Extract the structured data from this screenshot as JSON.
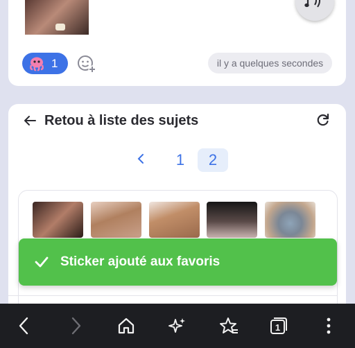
{
  "previous_post": {
    "reaction_count": "1",
    "timestamp": "il y a quelques secondes"
  },
  "topic_card": {
    "back_title": "Retou à liste des sujets",
    "pagination": {
      "pages": [
        "1",
        "2"
      ],
      "current": "2"
    }
  },
  "toast": {
    "message": "Sticker ajouté aux favoris"
  },
  "nav": {
    "tab_count": "1",
    "items": [
      "back-icon",
      "forward-icon",
      "home-icon",
      "sparkle-icon",
      "favorites-star-icon",
      "tabs-icon",
      "menu-icon"
    ]
  },
  "colors": {
    "accent": "#3d72e6",
    "toast_green": "#52c14b",
    "page_bg": "#dfe1ef",
    "navbar_bg": "#1d1e22"
  }
}
